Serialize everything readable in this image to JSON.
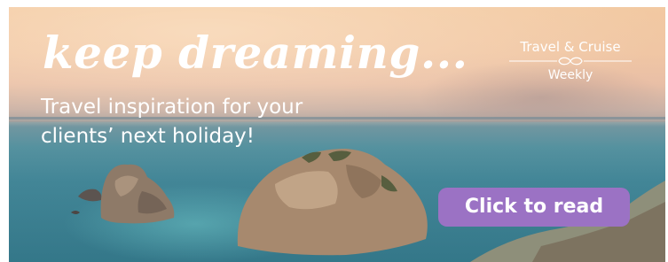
{
  "banner": {
    "headline": "keep dreaming...",
    "subline": "Travel inspiration for your clients’ next holiday!",
    "cta_label": "Click to read"
  },
  "logo": {
    "top": "Travel & Cruise",
    "bottom": "Weekly"
  },
  "colors": {
    "cta_background": "#9b72c4",
    "text": "#ffffff",
    "sky_top": "#f2c9a2",
    "sea": "#3b7a8b"
  }
}
